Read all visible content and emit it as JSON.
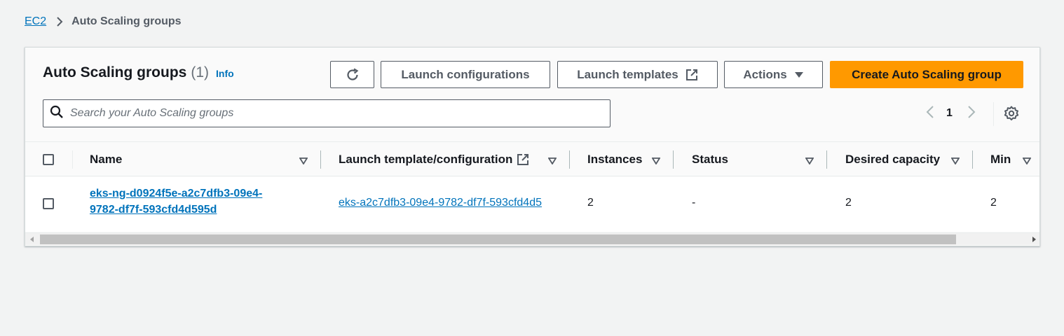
{
  "breadcrumb": {
    "root": "EC2",
    "current": "Auto Scaling groups"
  },
  "panel": {
    "title": "Auto Scaling groups",
    "count": "(1)",
    "info_label": "Info"
  },
  "toolbar": {
    "refresh_icon": "refresh-icon",
    "launch_configurations_label": "Launch configurations",
    "launch_templates_label": "Launch templates",
    "actions_label": "Actions",
    "create_label": "Create Auto Scaling group"
  },
  "search": {
    "placeholder": "Search your Auto Scaling groups",
    "value": ""
  },
  "pagination": {
    "current_page": "1"
  },
  "table": {
    "columns": {
      "name": "Name",
      "launch_template": "Launch template/configuration",
      "instances": "Instances",
      "status": "Status",
      "desired_capacity": "Desired capacity",
      "min": "Min"
    },
    "rows": [
      {
        "name_line1": "eks-ng-d0924f5e-a2c7dfb3-09e4-",
        "name_line2": "9782-df7f-593cfd4d595d",
        "launch_template": "eks-a2c7dfb3-09e4-9782-df7f-593cfd4d5",
        "instances": "2",
        "status": "-",
        "desired_capacity": "2",
        "min": "2"
      }
    ]
  },
  "colors": {
    "primary_button": "#ff9900",
    "link": "#0073bb",
    "background": "#f2f3f3"
  }
}
